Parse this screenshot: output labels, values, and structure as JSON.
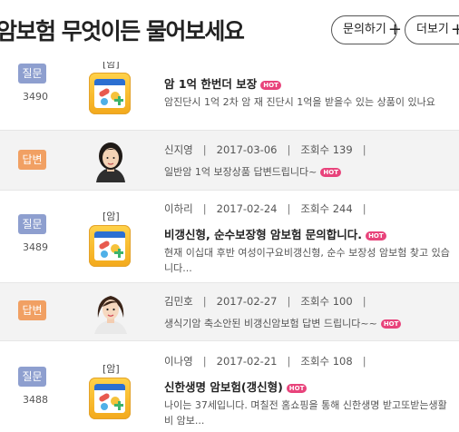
{
  "header": {
    "title": "암보험 무엇이든 물어보세요",
    "ask_label": "문의하기",
    "more_label": "더보기",
    "plus": "+"
  },
  "hot_label": "HOT",
  "items": [
    {
      "type": "question",
      "badge": "질문",
      "number": "3490",
      "category": "[암]",
      "title": "암 1억 한번더 보장",
      "desc": "암진단시 1억 2차 암 재 진단시 1억을 받을수 있는 상품이 있나요"
    },
    {
      "type": "answer",
      "badge": "답변",
      "author": "신지영",
      "date": "2017-03-06",
      "views_label": "조회수 139",
      "text": "일반암 1억 보장상품 답변드립니다~"
    },
    {
      "type": "question",
      "badge": "질문",
      "number": "3489",
      "category": "[암]",
      "author": "이하리",
      "date": "2017-02-24",
      "views_label": "조회수 244",
      "title": "비갱신형, 순수보장형 암보험 문의합니다.",
      "desc": "현재 이십대 후반 여성이구요비갱신형, 순수 보장성 암보험 찾고 있습니다..."
    },
    {
      "type": "answer",
      "badge": "답변",
      "author": "김민호",
      "date": "2017-02-27",
      "views_label": "조회수 100",
      "text": "생식기암 축소안된 비갱신암보험 답변 드립니다~~"
    },
    {
      "type": "question",
      "badge": "질문",
      "number": "3488",
      "category": "[암]",
      "author": "이나영",
      "date": "2017-02-21",
      "views_label": "조회수 108",
      "title": "신한생명 암보험(갱신형)",
      "desc": "나이는 37세입니다. 며칠전 홈쇼핑을 통해 신한생명 받고또받는생활비 암보..."
    }
  ],
  "separator": "|"
}
